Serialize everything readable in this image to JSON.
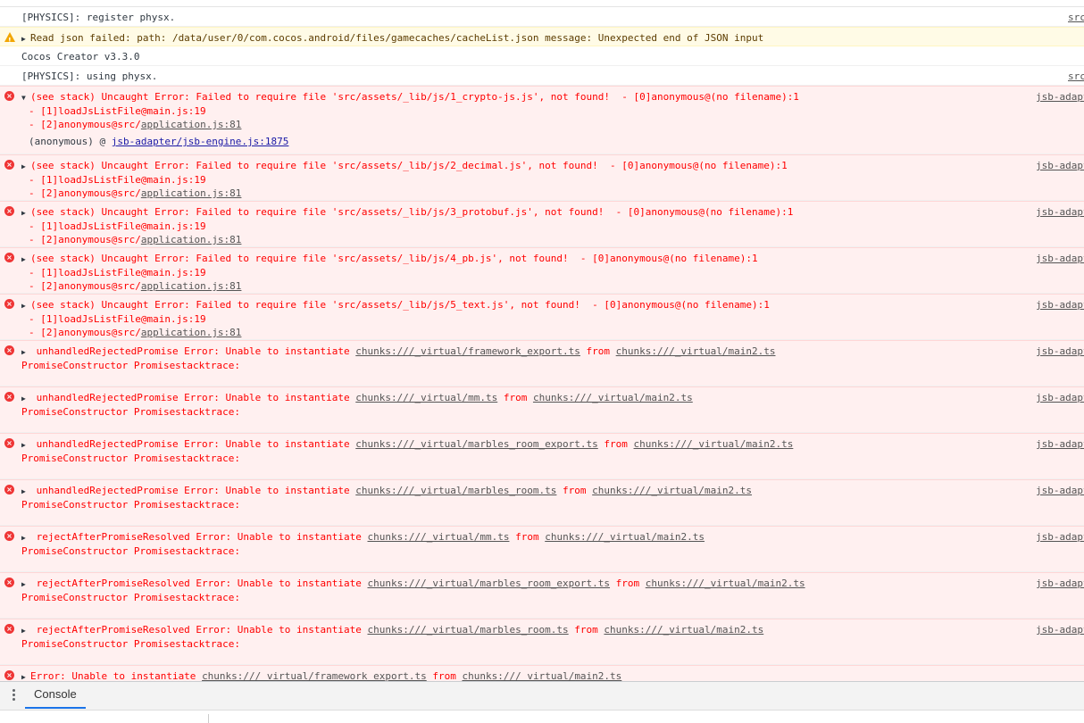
{
  "messages": [
    {
      "type": "info",
      "lines": [
        "[PHYSICS]: register physx."
      ],
      "source": "src"
    },
    {
      "type": "warn",
      "lines": [
        "Read json failed: path: /data/user/0/com.cocos.android/files/gamecaches/cacheList.json message: Unexpected end of JSON input"
      ],
      "source": ""
    },
    {
      "type": "info",
      "lines": [
        "Cocos Creator v3.3.0"
      ],
      "source": ""
    },
    {
      "type": "info",
      "lines": [
        "[PHYSICS]: using physx."
      ],
      "source": "src"
    },
    {
      "type": "err",
      "expanded": true,
      "lines": [
        "(see stack) Uncaught Error: Failed to require file 'src/assets/_lib/js/1_crypto-js.js', not found!  - [0]anonymous@(no filename):1",
        "- [1]loadJsListFile@main.js:19",
        "- [2]anonymous@src/application.js:81"
      ],
      "stack_label": "(anonymous) @ ",
      "stack_link": "jsb-adapter/jsb-engine.js:1875",
      "source": "jsb-adapter"
    },
    {
      "type": "err",
      "lines": [
        "(see stack) Uncaught Error: Failed to require file 'src/assets/_lib/js/2_decimal.js', not found!  - [0]anonymous@(no filename):1",
        "- [1]loadJsListFile@main.js:19",
        "- [2]anonymous@src/application.js:81"
      ],
      "source": "jsb-adapter"
    },
    {
      "type": "err",
      "lines": [
        "(see stack) Uncaught Error: Failed to require file 'src/assets/_lib/js/3_protobuf.js', not found!  - [0]anonymous@(no filename):1",
        "- [1]loadJsListFile@main.js:19",
        "- [2]anonymous@src/application.js:81"
      ],
      "source": "jsb-adapter"
    },
    {
      "type": "err",
      "lines": [
        "(see stack) Uncaught Error: Failed to require file 'src/assets/_lib/js/4_pb.js', not found!  - [0]anonymous@(no filename):1",
        "- [1]loadJsListFile@main.js:19",
        "- [2]anonymous@src/application.js:81"
      ],
      "source": "jsb-adapter"
    },
    {
      "type": "err",
      "lines": [
        "(see stack) Uncaught Error: Failed to require file 'src/assets/_lib/js/5_text.js', not found!  - [0]anonymous@(no filename):1",
        "- [1]loadJsListFile@main.js:19",
        "- [2]anonymous@src/application.js:81"
      ],
      "source": "jsb-adapter"
    },
    {
      "type": "err",
      "lines": [
        " unhandledRejectedPromise Error: Unable to instantiate chunks:///_virtual/framework_export.ts from chunks:///_virtual/main2.ts",
        "PromiseConstructor Promisestacktrace:"
      ],
      "source": "jsb-adapter"
    },
    {
      "type": "err",
      "lines": [
        " unhandledRejectedPromise Error: Unable to instantiate chunks:///_virtual/mm.ts from chunks:///_virtual/main2.ts",
        "PromiseConstructor Promisestacktrace:"
      ],
      "source": "jsb-adapter"
    },
    {
      "type": "err",
      "lines": [
        " unhandledRejectedPromise Error: Unable to instantiate chunks:///_virtual/marbles_room_export.ts from chunks:///_virtual/main2.ts",
        "PromiseConstructor Promisestacktrace:"
      ],
      "source": "jsb-adapter"
    },
    {
      "type": "err",
      "lines": [
        " unhandledRejectedPromise Error: Unable to instantiate chunks:///_virtual/marbles_room.ts from chunks:///_virtual/main2.ts",
        "PromiseConstructor Promisestacktrace:"
      ],
      "source": "jsb-adapter"
    },
    {
      "type": "err",
      "lines": [
        " rejectAfterPromiseResolved Error: Unable to instantiate chunks:///_virtual/mm.ts from chunks:///_virtual/main2.ts",
        "PromiseConstructor Promisestacktrace:"
      ],
      "source": "jsb-adapter"
    },
    {
      "type": "err",
      "lines": [
        " rejectAfterPromiseResolved Error: Unable to instantiate chunks:///_virtual/marbles_room_export.ts from chunks:///_virtual/main2.ts",
        "PromiseConstructor Promisestacktrace:"
      ],
      "source": "jsb-adapter"
    },
    {
      "type": "err",
      "lines": [
        " rejectAfterPromiseResolved Error: Unable to instantiate chunks:///_virtual/marbles_room.ts from chunks:///_virtual/main2.ts",
        "PromiseConstructor Promisestacktrace:"
      ],
      "source": "jsb-adapter"
    },
    {
      "type": "err",
      "lines": [
        "Error: Unable to instantiate chunks:///_virtual/framework_export.ts from chunks:///_virtual/main2.ts"
      ],
      "source": ""
    }
  ],
  "drawer": {
    "tab_label": "Console"
  },
  "icons": {
    "error": "error-circle-icon",
    "warning": "warning-triangle-icon",
    "expand": "triangle-expand-icon",
    "menu": "kebab-menu-icon"
  },
  "colors": {
    "error_text": "#ff0000",
    "error_bg": "#fff0f0",
    "warn_bg": "#fffbe6",
    "tab_accent": "#1a73e8"
  }
}
